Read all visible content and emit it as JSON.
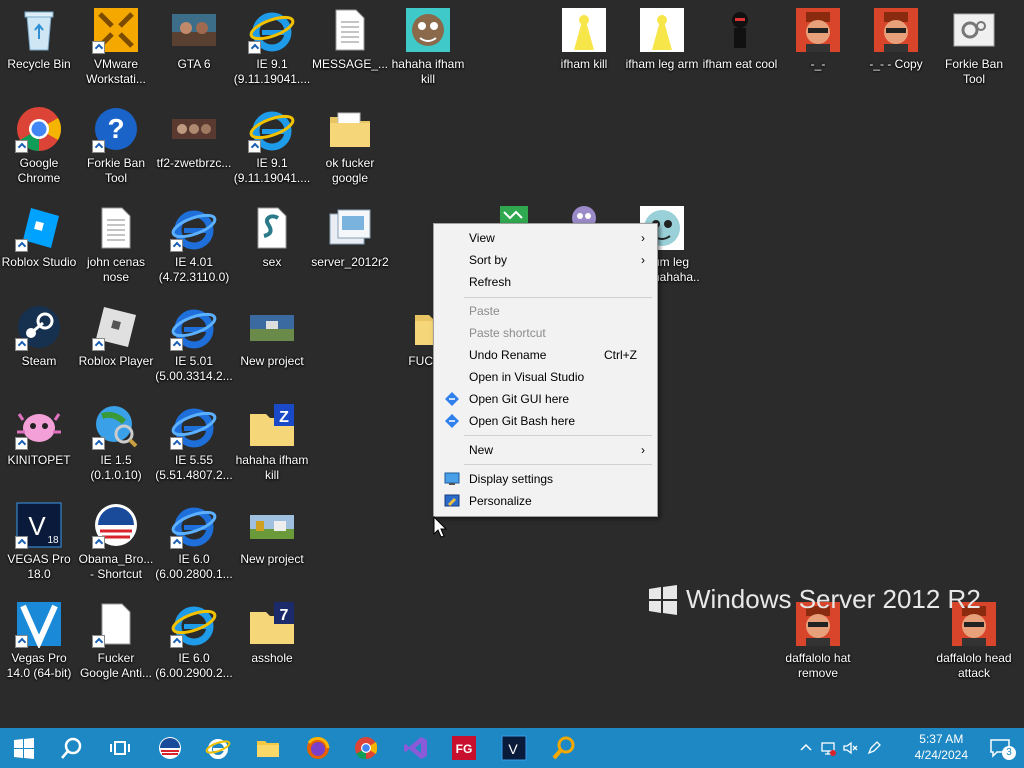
{
  "desktop": {
    "icons": [
      {
        "label": "Recycle Bin",
        "icon": "recycle-bin-icon"
      },
      {
        "label": "VMware Workstati...",
        "icon": "vmware-icon"
      },
      {
        "label": "GTA 6",
        "icon": "gta-image-icon"
      },
      {
        "label": "IE 9.1 (9.11.19041....",
        "icon": "ie-icon"
      },
      {
        "label": "MESSAGE_...",
        "icon": "text-file-icon"
      },
      {
        "label": "hahaha ifham kill",
        "icon": "image-icon"
      },
      {
        "label": "ifham kill",
        "icon": "image-icon"
      },
      {
        "label": "ifham leg arm",
        "icon": "image-icon"
      },
      {
        "label": "ifham eat cool",
        "icon": "image-icon"
      },
      {
        "label": "-_-",
        "icon": "image-icon"
      },
      {
        "label": "-_- - Copy",
        "icon": "image-icon"
      },
      {
        "label": "Forkie Ban Tool",
        "icon": "settings-file-icon"
      },
      {
        "label": "Google Chrome",
        "icon": "chrome-icon"
      },
      {
        "label": "Forkie Ban Tool",
        "icon": "help-icon"
      },
      {
        "label": "tf2-zwetbrzc...",
        "icon": "image-icon"
      },
      {
        "label": "IE 9.1 (9.11.19041....",
        "icon": "ie-icon"
      },
      {
        "label": "ok fucker google",
        "icon": "folder-icon"
      },
      {
        "label": "Roblox Studio",
        "icon": "roblox-studio-icon"
      },
      {
        "label": "john cenas nose",
        "icon": "text-file-icon"
      },
      {
        "label": "IE 4.01 (4.72.3110.0)",
        "icon": "ie-icon"
      },
      {
        "label": "sex",
        "icon": "script-file-icon"
      },
      {
        "label": "server_2012r2",
        "icon": "server-file-icon"
      },
      {
        "label": "Steam",
        "icon": "steam-icon"
      },
      {
        "label": "Roblox Player",
        "icon": "roblox-icon"
      },
      {
        "label": "IE 5.01 (5.00.3314.2...",
        "icon": "ie-icon"
      },
      {
        "label": "New project",
        "icon": "video-project-icon"
      },
      {
        "label": "FUC",
        "icon": "folder-icon"
      },
      {
        "label": "KINITOPET",
        "icon": "kinitopet-icon"
      },
      {
        "label": "IE 1.5 (0.1.0.10)",
        "icon": "ie-old-icon"
      },
      {
        "label": "IE 5.55 (5.51.4807.2...",
        "icon": "ie-icon"
      },
      {
        "label": "hahaha ifham kill",
        "icon": "zip-folder-icon"
      },
      {
        "label": "VEGAS Pro 18.0",
        "icon": "vegas-icon"
      },
      {
        "label": "Obama_Bro... - Shortcut",
        "icon": "obama-icon"
      },
      {
        "label": "IE 6.0 (6.00.2800.1...",
        "icon": "ie-icon"
      },
      {
        "label": "New project",
        "icon": "video-project-icon"
      },
      {
        "label": "Vegas Pro 14.0 (64-bit)",
        "icon": "vegas-icon"
      },
      {
        "label": "Fucker Google Anti...",
        "icon": "blank-file-icon"
      },
      {
        "label": "IE 6.0 (6.00.2900.2...",
        "icon": "ie-icon"
      },
      {
        "label": "asshole",
        "icon": "zip-folder-icon"
      },
      {
        "label": "daffalolo hat remove",
        "icon": "image-icon"
      },
      {
        "label": "daffalolo head attack",
        "icon": "image-icon"
      },
      {
        "label": "",
        "icon": "image-icon"
      },
      {
        "label": "",
        "icon": "image-icon"
      },
      {
        "label": "um leg hahaha...",
        "icon": "image-icon"
      }
    ],
    "watermark": "Windows Server 2012 R2"
  },
  "context_menu": {
    "view": "View",
    "sort_by": "Sort by",
    "refresh": "Refresh",
    "paste": "Paste",
    "paste_shortcut": "Paste shortcut",
    "undo_rename": "Undo Rename",
    "undo_shortcut": "Ctrl+Z",
    "open_vs": "Open in Visual Studio",
    "open_git_gui": "Open Git GUI here",
    "open_git_bash": "Open Git Bash here",
    "new": "New",
    "display_settings": "Display settings",
    "personalize": "Personalize"
  },
  "taskbar": {
    "time": "5:37 AM",
    "date": "4/24/2024",
    "notification_count": "3",
    "apps": [
      "start-icon",
      "search-icon",
      "task-view-icon",
      "obama-icon",
      "ie-icon",
      "file-explorer-icon",
      "firefox-icon",
      "chrome-icon",
      "visual-studio-icon",
      "fg-icon",
      "vegas-icon",
      "search-tool-icon"
    ]
  },
  "colors": {
    "taskbar": "#1d88c4",
    "desktop": "#2b2b2b",
    "menu": "#f2f2f2"
  }
}
